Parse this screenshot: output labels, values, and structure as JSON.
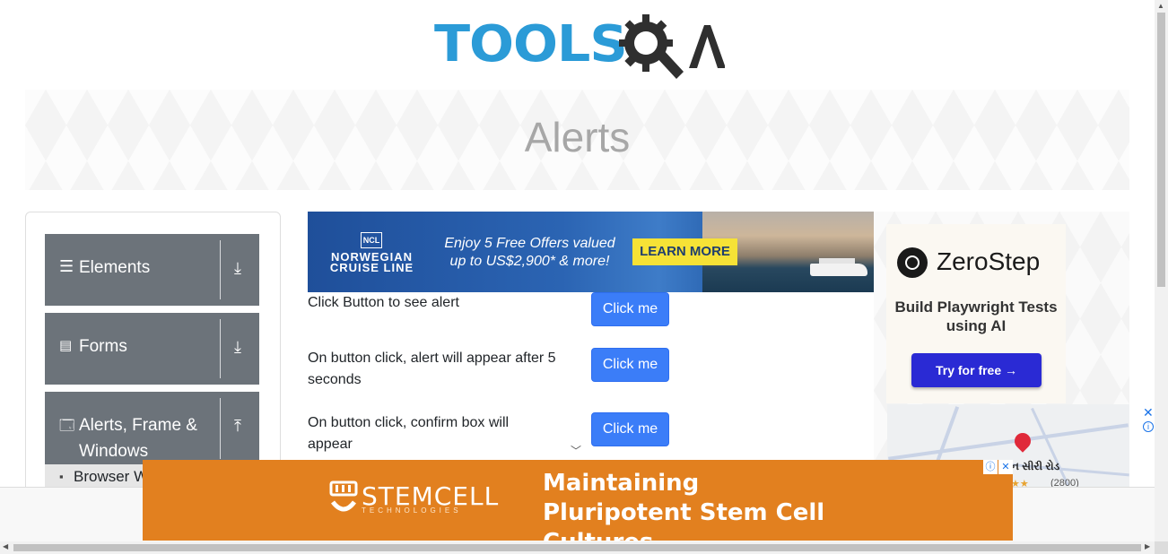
{
  "header": {
    "logo_text": "TOOLS",
    "logo_suffix": "A"
  },
  "banner": {
    "title": "Alerts"
  },
  "sidebar": {
    "groups": [
      {
        "label": "Elements",
        "icon": "hamburger-icon",
        "arrow": "download-arrow-icon"
      },
      {
        "label": "Forms",
        "icon": "document-icon",
        "arrow": "download-arrow-icon"
      },
      {
        "label": "Alerts, Frame & Windows",
        "icon": "window-icon",
        "arrow": "upload-arrow-icon"
      }
    ],
    "sub_item": {
      "label": "Browser Windows"
    }
  },
  "ads": {
    "main": {
      "brand_flag": "NCL",
      "brand": "NORWEGIAN CRUISE LINE",
      "offer": "Enjoy 5 Free Offers valued up to US$2,900* & more!",
      "cta": "LEARN MORE"
    },
    "right": {
      "brand": "ZeroStep",
      "headline": "Build Playwright Tests using AI",
      "cta": "Try for free →",
      "map_label": "ન સીરી રોડ",
      "map_rating": "(2800)"
    },
    "bottom": {
      "brand": "STEMCELL",
      "brand_sub": "TECHNOLOGIES",
      "headline": "Maintaining Pluripotent Stem Cell Cultures"
    }
  },
  "alerts": [
    {
      "text": "Click Button to see alert",
      "button": "Click me"
    },
    {
      "text": "On button click, alert will appear after 5 seconds",
      "button": "Click me"
    },
    {
      "text": "On button click, confirm box will appear",
      "button": "Click me"
    }
  ],
  "colors": {
    "brand_blue": "#2b9bd7",
    "button": "#3b7df8",
    "sidebar_group": "#6c737a",
    "ad_orange": "#e2801f"
  }
}
